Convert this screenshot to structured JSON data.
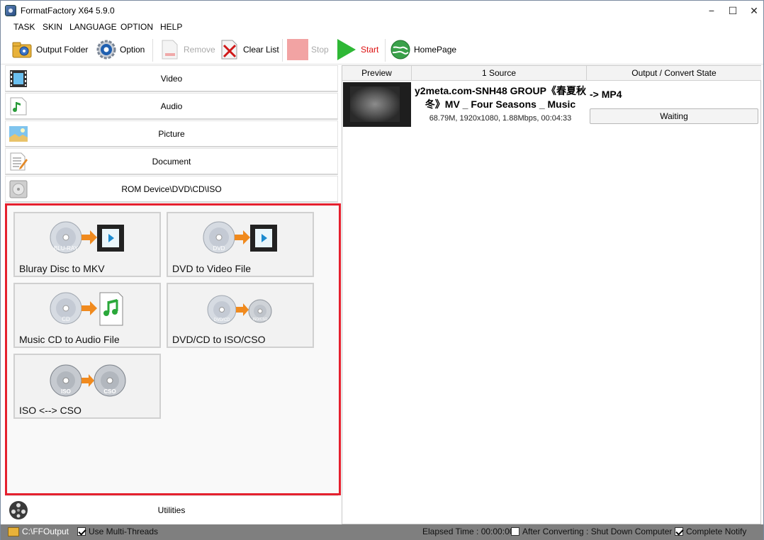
{
  "window": {
    "title": "FormatFactory X64 5.9.0",
    "minimize": "−",
    "maximize": "☐",
    "close": "✕"
  },
  "menu": [
    "TASK",
    "SKIN",
    "LANGUAGE",
    "OPTION",
    "HELP"
  ],
  "toolbar": {
    "output_folder": "Output Folder",
    "option": "Option",
    "remove": "Remove",
    "clear_list": "Clear List",
    "stop": "Stop",
    "start": "Start",
    "homepage": "HomePage"
  },
  "categories": {
    "video": "Video",
    "audio": "Audio",
    "picture": "Picture",
    "document": "Document",
    "rom": "ROM Device\\DVD\\CD\\ISO",
    "utilities": "Utilities"
  },
  "rom_tasks": [
    {
      "label": "Bluray Disc to MKV",
      "disc_text": "BLU-RAY"
    },
    {
      "label": "DVD to Video File",
      "disc_text": "DVD"
    },
    {
      "label": "Music CD to Audio File",
      "disc_text": "CD"
    },
    {
      "label": "DVD/CD to ISO/CSO",
      "disc_text": "DVD/CD",
      "target_text": "ISO/CSO"
    },
    {
      "label": "ISO <--> CSO",
      "disc_text": "ISO",
      "target_text": "CSO"
    }
  ],
  "list": {
    "headers": {
      "preview": "Preview",
      "source": "1 Source",
      "output": "Output / Convert State"
    },
    "items": [
      {
        "title": "y2meta.com-SNH48 GROUP《春夏秋冬》MV _ Four Seasons _ Music",
        "info": "68.79M, 1920x1080, 1.88Mbps, 00:04:33",
        "output": "-> MP4",
        "state": "Waiting"
      }
    ]
  },
  "status": {
    "output_path": "C:\\FFOutput",
    "multi_threads": "Use Multi-Threads",
    "elapsed": "Elapsed Time : 00:00:00",
    "after_converting": "After Converting : Shut Down Computer",
    "complete_notify": "Complete Notify"
  },
  "colors": {
    "highlight_border": "#e5202e",
    "start_text": "#dd1111",
    "statusbar": "#7f7f7f"
  }
}
